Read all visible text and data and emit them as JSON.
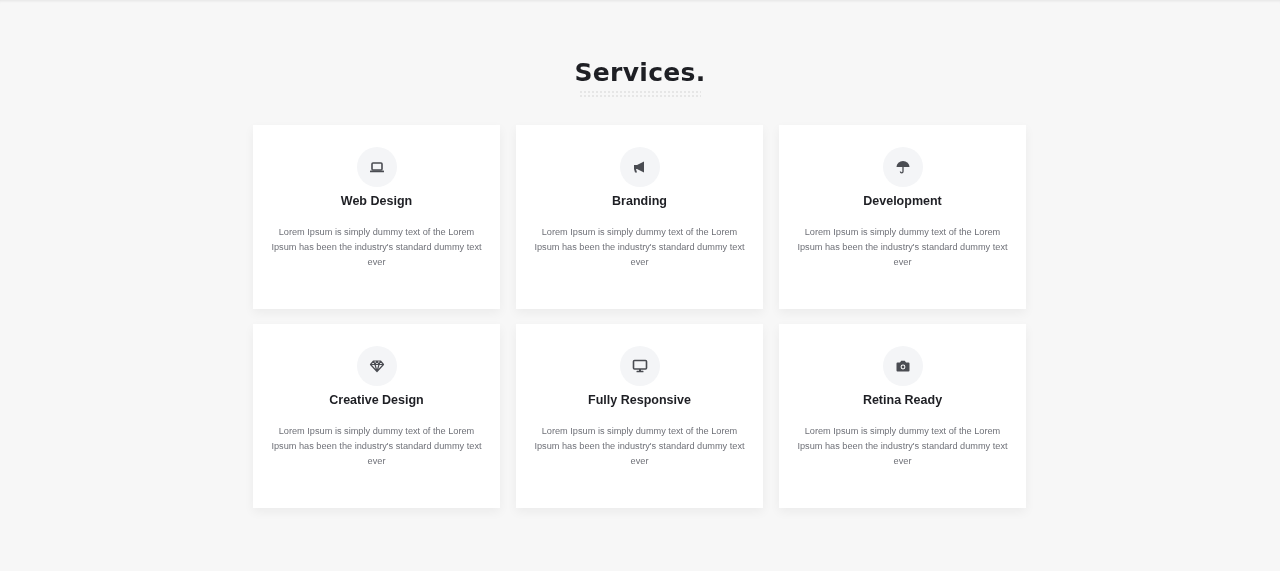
{
  "section": {
    "title": "Services."
  },
  "services": [
    {
      "title": "Web Design",
      "text": "Lorem Ipsum is simply dummy text of the Lorem Ipsum has been the industry's standard dummy text ever"
    },
    {
      "title": "Branding",
      "text": "Lorem Ipsum is simply dummy text of the Lorem Ipsum has been the industry's standard dummy text ever"
    },
    {
      "title": "Development",
      "text": "Lorem Ipsum is simply dummy text of the Lorem Ipsum has been the industry's standard dummy text ever"
    },
    {
      "title": "Creative Design",
      "text": "Lorem Ipsum is simply dummy text of the Lorem Ipsum has been the industry's standard dummy text ever"
    },
    {
      "title": "Fully Responsive",
      "text": "Lorem Ipsum is simply dummy text of the Lorem Ipsum has been the industry's standard dummy text ever"
    },
    {
      "title": "Retina Ready",
      "text": "Lorem Ipsum is simply dummy text of the Lorem Ipsum has been the industry's standard dummy text ever"
    }
  ]
}
